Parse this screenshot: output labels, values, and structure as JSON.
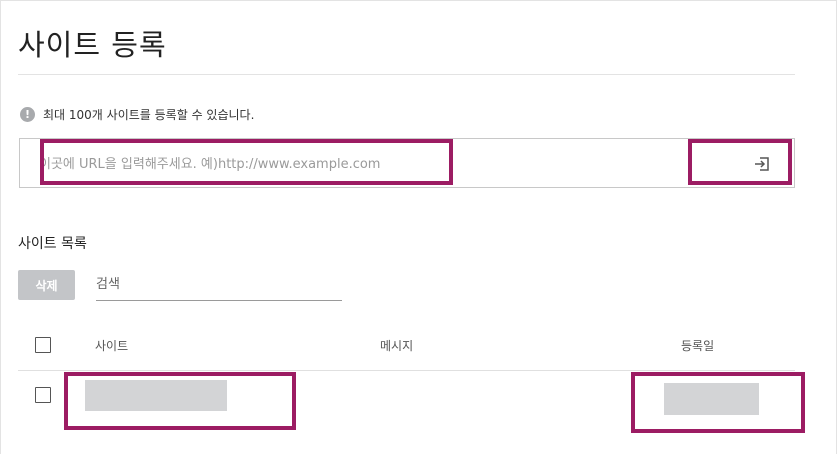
{
  "header": {
    "title": "사이트 등록"
  },
  "notice": {
    "icon": "info-icon",
    "text": "최대 100개 사이트를 등록할 수 있습니다."
  },
  "url_form": {
    "placeholder": "이곳에 URL을 입력해주세요. 예)http://www.example.com",
    "value": "",
    "submit_icon": "enter-arrow-icon"
  },
  "site_list": {
    "title": "사이트 목록",
    "delete_label": "삭제",
    "search_placeholder": "검색",
    "columns": [
      "사이트",
      "메시지",
      "등록일"
    ],
    "rows": [
      {
        "site": "",
        "message": "",
        "date": ""
      }
    ]
  },
  "colors": {
    "highlight": "#9c1c63",
    "disabled_button": "#c3c5c8",
    "redacted_block": "#d3d4d6"
  }
}
